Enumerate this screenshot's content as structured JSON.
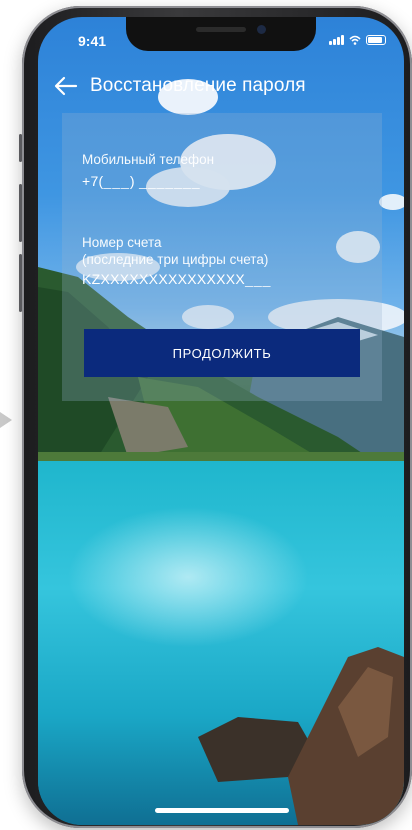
{
  "status_bar": {
    "time": "9:41"
  },
  "header": {
    "title": "Восстановление пароля",
    "back_icon": "arrow-left-icon"
  },
  "form": {
    "phone": {
      "label": "Мобильный телефон",
      "prefix": "+7(",
      "mask_area": "___",
      "close": ")",
      "mask_number": "_______"
    },
    "account": {
      "label": "Номер счета",
      "hint": "(последние три цифры счета)",
      "prefix": "KZXXXXXXXXXXXXXXX",
      "mask": "___"
    },
    "continue_label": "ПРОДОЛЖИТЬ"
  },
  "colors": {
    "button": "#0b2a7d",
    "panel": "rgba(150,180,210,.28)"
  }
}
